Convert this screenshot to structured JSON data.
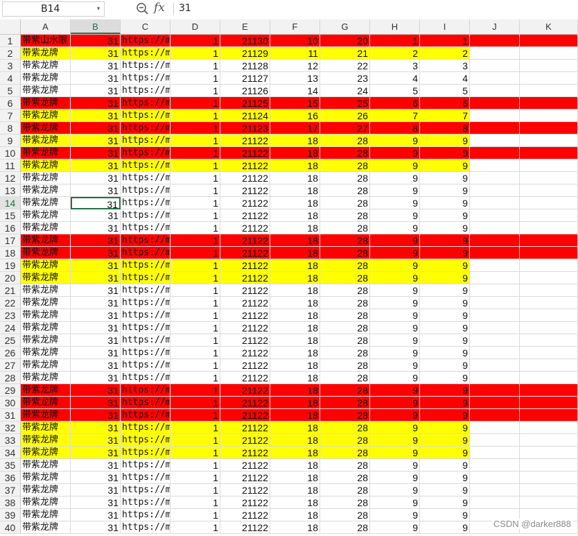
{
  "formula_bar": {
    "cell_reference": "B14",
    "formula_value": "31",
    "fx_label": "fx"
  },
  "columns": [
    "A",
    "B",
    "C",
    "D",
    "E",
    "F",
    "G",
    "H",
    "I",
    "J",
    "K"
  ],
  "selected_column": "B",
  "selected_row": 14,
  "active_cell": "B14",
  "colors": {
    "red": "#ff0000",
    "yellow": "#ffff00",
    "selection": "#217346"
  },
  "rows": [
    {
      "num": "1",
      "fill": "red",
      "fill_extends": true,
      "a": "带紫山水眼",
      "b": "31",
      "c": "https://m",
      "d": "1",
      "e": "21130",
      "f": "10",
      "g": "20",
      "h": "1",
      "i": "1"
    },
    {
      "num": "2",
      "fill": "yellow",
      "fill_extends": false,
      "a": "带紫龙牌",
      "b": "31",
      "c": "https://m",
      "d": "1",
      "e": "21129",
      "f": "11",
      "g": "21",
      "h": "2",
      "i": "2"
    },
    {
      "num": "3",
      "fill": "none",
      "fill_extends": false,
      "a": "带紫龙牌",
      "b": "31",
      "c": "https://m",
      "d": "1",
      "e": "21128",
      "f": "12",
      "g": "22",
      "h": "3",
      "i": "3"
    },
    {
      "num": "4",
      "fill": "none",
      "fill_extends": false,
      "a": "带紫龙牌",
      "b": "31",
      "c": "https://m",
      "d": "1",
      "e": "21127",
      "f": "13",
      "g": "23",
      "h": "4",
      "i": "4"
    },
    {
      "num": "5",
      "fill": "none",
      "fill_extends": false,
      "a": "带紫龙牌",
      "b": "31",
      "c": "https://m",
      "d": "1",
      "e": "21126",
      "f": "14",
      "g": "24",
      "h": "5",
      "i": "5"
    },
    {
      "num": "6",
      "fill": "red",
      "fill_extends": true,
      "a": "带紫龙牌",
      "b": "31",
      "c": "https://m",
      "d": "1",
      "e": "21125",
      "f": "15",
      "g": "25",
      "h": "6",
      "i": "6"
    },
    {
      "num": "7",
      "fill": "yellow",
      "fill_extends": false,
      "a": "带紫龙牌",
      "b": "31",
      "c": "https://m",
      "d": "1",
      "e": "21124",
      "f": "16",
      "g": "26",
      "h": "7",
      "i": "7"
    },
    {
      "num": "8",
      "fill": "red",
      "fill_extends": true,
      "a": "带紫龙牌",
      "b": "31",
      "c": "https://m",
      "d": "1",
      "e": "21123",
      "f": "17",
      "g": "27",
      "h": "8",
      "i": "8"
    },
    {
      "num": "9",
      "fill": "yellow",
      "fill_extends": false,
      "a": "带紫龙牌",
      "b": "31",
      "c": "https://m",
      "d": "1",
      "e": "21122",
      "f": "18",
      "g": "28",
      "h": "9",
      "i": "9"
    },
    {
      "num": "10",
      "fill": "red",
      "fill_extends": true,
      "a": "带紫龙牌",
      "b": "31",
      "c": "https://m",
      "d": "1",
      "e": "21122",
      "f": "18",
      "g": "28",
      "h": "9",
      "i": "9"
    },
    {
      "num": "11",
      "fill": "yellow",
      "fill_extends": false,
      "a": "带紫龙牌",
      "b": "31",
      "c": "https://m",
      "d": "1",
      "e": "21122",
      "f": "18",
      "g": "28",
      "h": "9",
      "i": "9"
    },
    {
      "num": "12",
      "fill": "none",
      "fill_extends": false,
      "a": "带紫龙牌",
      "b": "31",
      "c": "https://m",
      "d": "1",
      "e": "21122",
      "f": "18",
      "g": "28",
      "h": "9",
      "i": "9"
    },
    {
      "num": "13",
      "fill": "none",
      "fill_extends": false,
      "a": "带紫龙牌",
      "b": "31",
      "c": "https://m",
      "d": "1",
      "e": "21122",
      "f": "18",
      "g": "28",
      "h": "9",
      "i": "9"
    },
    {
      "num": "14",
      "fill": "none",
      "fill_extends": false,
      "a": "带紫龙牌",
      "b": "31",
      "c": "https://m",
      "d": "1",
      "e": "21122",
      "f": "18",
      "g": "28",
      "h": "9",
      "i": "9"
    },
    {
      "num": "15",
      "fill": "none",
      "fill_extends": false,
      "a": "带紫龙牌",
      "b": "31",
      "c": "https://m",
      "d": "1",
      "e": "21122",
      "f": "18",
      "g": "28",
      "h": "9",
      "i": "9"
    },
    {
      "num": "16",
      "fill": "none",
      "fill_extends": false,
      "a": "带紫龙牌",
      "b": "31",
      "c": "https://m",
      "d": "1",
      "e": "21122",
      "f": "18",
      "g": "28",
      "h": "9",
      "i": "9"
    },
    {
      "num": "17",
      "fill": "red",
      "fill_extends": true,
      "a": "带紫龙牌",
      "b": "31",
      "c": "https://m",
      "d": "1",
      "e": "21122",
      "f": "18",
      "g": "28",
      "h": "9",
      "i": "9"
    },
    {
      "num": "18",
      "fill": "red",
      "fill_extends": true,
      "a": "带紫龙牌",
      "b": "31",
      "c": "https://m",
      "d": "1",
      "e": "21122",
      "f": "18",
      "g": "28",
      "h": "9",
      "i": "9"
    },
    {
      "num": "19",
      "fill": "yellow",
      "fill_extends": false,
      "a": "带紫龙牌",
      "b": "31",
      "c": "https://m",
      "d": "1",
      "e": "21122",
      "f": "18",
      "g": "28",
      "h": "9",
      "i": "9"
    },
    {
      "num": "20",
      "fill": "yellow",
      "fill_extends": false,
      "a": "带紫龙牌",
      "b": "31",
      "c": "https://m",
      "d": "1",
      "e": "21122",
      "f": "18",
      "g": "28",
      "h": "9",
      "i": "9"
    },
    {
      "num": "21",
      "fill": "none",
      "fill_extends": false,
      "a": "带紫龙牌",
      "b": "31",
      "c": "https://m",
      "d": "1",
      "e": "21122",
      "f": "18",
      "g": "28",
      "h": "9",
      "i": "9"
    },
    {
      "num": "22",
      "fill": "none",
      "fill_extends": false,
      "a": "带紫龙牌",
      "b": "31",
      "c": "https://m",
      "d": "1",
      "e": "21122",
      "f": "18",
      "g": "28",
      "h": "9",
      "i": "9"
    },
    {
      "num": "23",
      "fill": "none",
      "fill_extends": false,
      "a": "带紫龙牌",
      "b": "31",
      "c": "https://m",
      "d": "1",
      "e": "21122",
      "f": "18",
      "g": "28",
      "h": "9",
      "i": "9"
    },
    {
      "num": "24",
      "fill": "none",
      "fill_extends": false,
      "a": "带紫龙牌",
      "b": "31",
      "c": "https://m",
      "d": "1",
      "e": "21122",
      "f": "18",
      "g": "28",
      "h": "9",
      "i": "9"
    },
    {
      "num": "25",
      "fill": "none",
      "fill_extends": false,
      "a": "带紫龙牌",
      "b": "31",
      "c": "https://m",
      "d": "1",
      "e": "21122",
      "f": "18",
      "g": "28",
      "h": "9",
      "i": "9"
    },
    {
      "num": "26",
      "fill": "none",
      "fill_extends": false,
      "a": "带紫龙牌",
      "b": "31",
      "c": "https://m",
      "d": "1",
      "e": "21122",
      "f": "18",
      "g": "28",
      "h": "9",
      "i": "9"
    },
    {
      "num": "27",
      "fill": "none",
      "fill_extends": false,
      "a": "带紫龙牌",
      "b": "31",
      "c": "https://m",
      "d": "1",
      "e": "21122",
      "f": "18",
      "g": "28",
      "h": "9",
      "i": "9"
    },
    {
      "num": "28",
      "fill": "none",
      "fill_extends": false,
      "a": "带紫龙牌",
      "b": "31",
      "c": "https://m",
      "d": "1",
      "e": "21122",
      "f": "18",
      "g": "28",
      "h": "9",
      "i": "9"
    },
    {
      "num": "29",
      "fill": "red",
      "fill_extends": true,
      "a": "带紫龙牌",
      "b": "31",
      "c": "https://m",
      "d": "1",
      "e": "21122",
      "f": "18",
      "g": "28",
      "h": "9",
      "i": "9"
    },
    {
      "num": "30",
      "fill": "red",
      "fill_extends": true,
      "a": "带紫龙牌",
      "b": "31",
      "c": "https://m",
      "d": "1",
      "e": "21122",
      "f": "18",
      "g": "28",
      "h": "9",
      "i": "9"
    },
    {
      "num": "31",
      "fill": "red",
      "fill_extends": true,
      "a": "带紫龙牌",
      "b": "31",
      "c": "https://m",
      "d": "1",
      "e": "21122",
      "f": "18",
      "g": "28",
      "h": "9",
      "i": "9"
    },
    {
      "num": "32",
      "fill": "yellow",
      "fill_extends": false,
      "a": "带紫龙牌",
      "b": "31",
      "c": "https://m",
      "d": "1",
      "e": "21122",
      "f": "18",
      "g": "28",
      "h": "9",
      "i": "9"
    },
    {
      "num": "33",
      "fill": "yellow",
      "fill_extends": false,
      "a": "带紫龙牌",
      "b": "31",
      "c": "https://m",
      "d": "1",
      "e": "21122",
      "f": "18",
      "g": "28",
      "h": "9",
      "i": "9"
    },
    {
      "num": "34",
      "fill": "yellow",
      "fill_extends": false,
      "a": "带紫龙牌",
      "b": "31",
      "c": "https://m",
      "d": "1",
      "e": "21122",
      "f": "18",
      "g": "28",
      "h": "9",
      "i": "9"
    },
    {
      "num": "35",
      "fill": "none",
      "fill_extends": false,
      "a": "带紫龙牌",
      "b": "31",
      "c": "https://m",
      "d": "1",
      "e": "21122",
      "f": "18",
      "g": "28",
      "h": "9",
      "i": "9"
    },
    {
      "num": "36",
      "fill": "none",
      "fill_extends": false,
      "a": "带紫龙牌",
      "b": "31",
      "c": "https://m",
      "d": "1",
      "e": "21122",
      "f": "18",
      "g": "28",
      "h": "9",
      "i": "9"
    },
    {
      "num": "37",
      "fill": "none",
      "fill_extends": false,
      "a": "带紫龙牌",
      "b": "31",
      "c": "https://m",
      "d": "1",
      "e": "21122",
      "f": "18",
      "g": "28",
      "h": "9",
      "i": "9"
    },
    {
      "num": "38",
      "fill": "none",
      "fill_extends": false,
      "a": "带紫龙牌",
      "b": "31",
      "c": "https://m",
      "d": "1",
      "e": "21122",
      "f": "18",
      "g": "28",
      "h": "9",
      "i": "9"
    },
    {
      "num": "39",
      "fill": "none",
      "fill_extends": false,
      "a": "带紫龙牌",
      "b": "31",
      "c": "https://m",
      "d": "1",
      "e": "21122",
      "f": "18",
      "g": "28",
      "h": "9",
      "i": "9"
    },
    {
      "num": "40",
      "fill": "none",
      "fill_extends": false,
      "a": "带紫龙牌",
      "b": "31",
      "c": "https://m",
      "d": "1",
      "e": "21122",
      "f": "18",
      "g": "28",
      "h": "9",
      "i": "9"
    }
  ],
  "watermark": "CSDN @darker888"
}
